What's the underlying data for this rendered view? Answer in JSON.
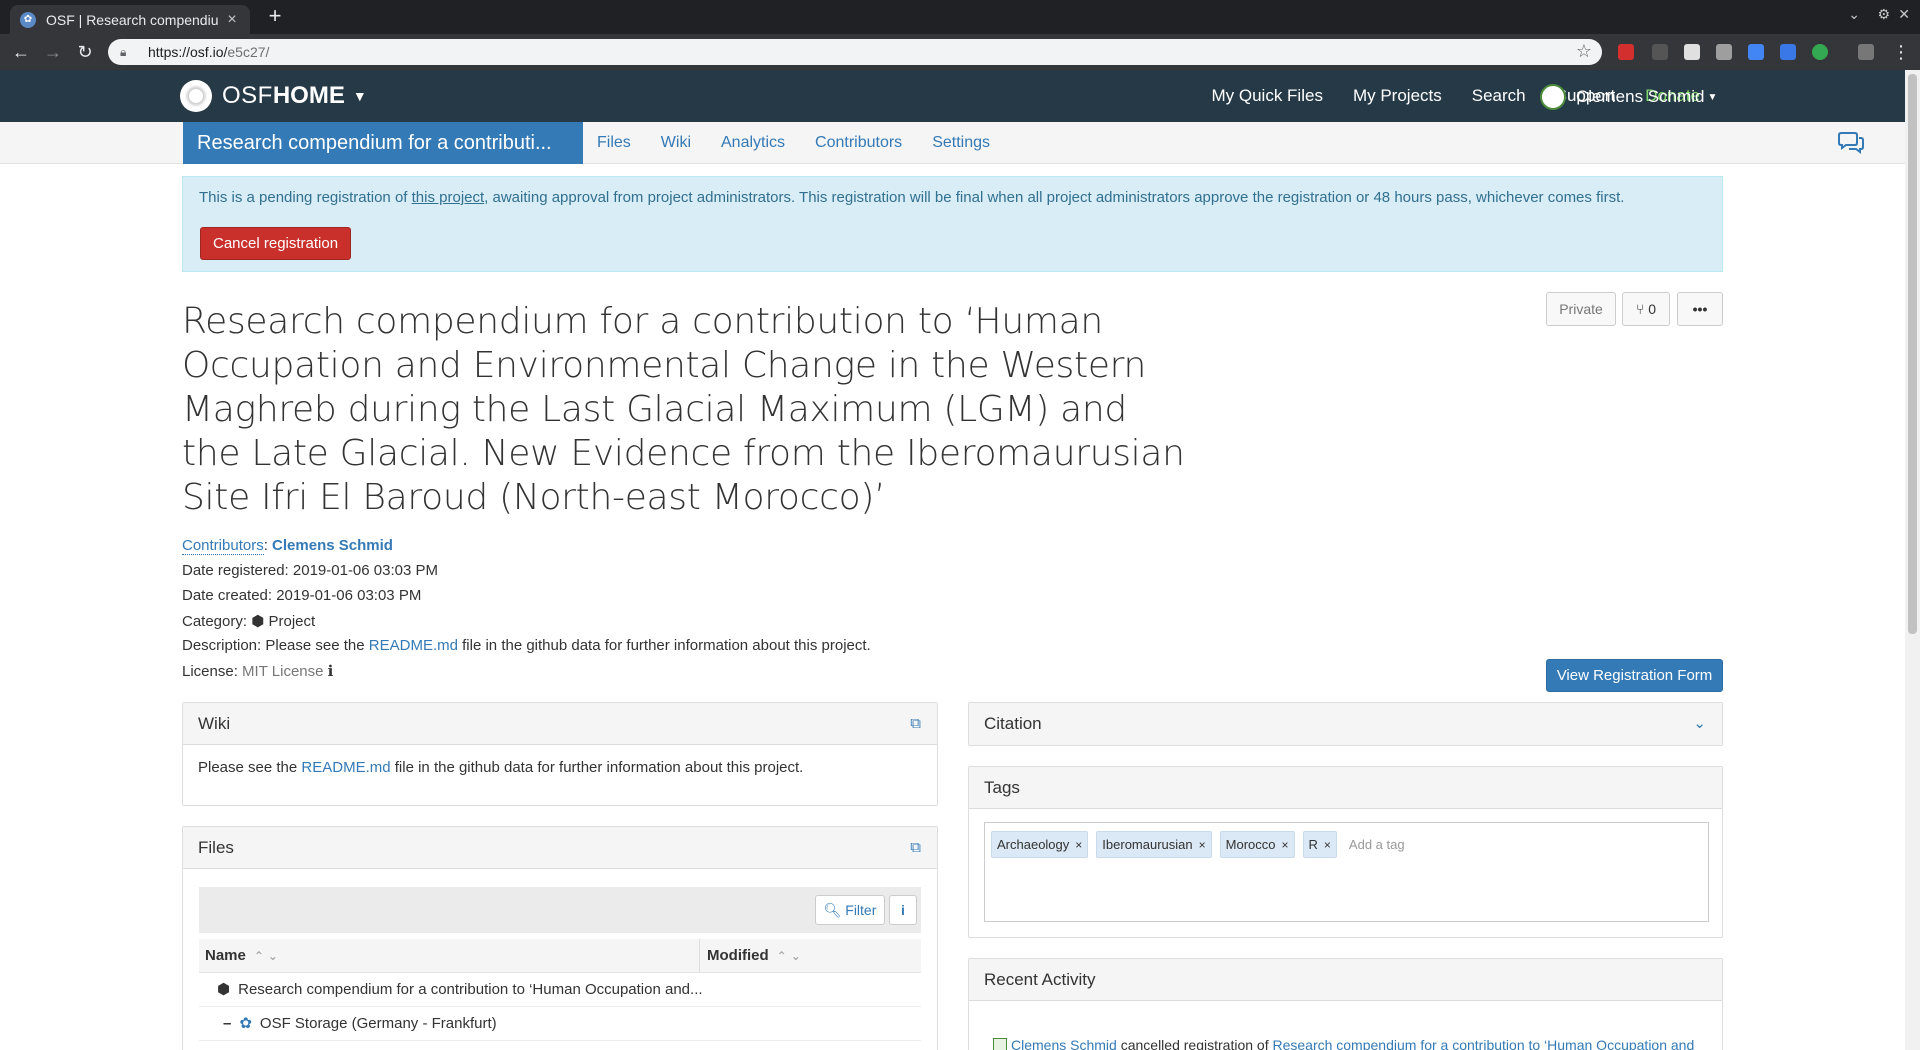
{
  "browser": {
    "tab_title": "OSF | Research compendium f",
    "url_host": "https://osf.io/",
    "url_path": "e5c27/"
  },
  "osfnav": {
    "logo_osf": "OSF",
    "logo_home": "HOME",
    "links": [
      "My Quick Files",
      "My Projects",
      "Search",
      "Support",
      "Donate"
    ],
    "user": "Clemens Schmid"
  },
  "subnav": {
    "project_title": "Research compendium for a contributi...",
    "links": [
      "Files",
      "Wiki",
      "Analytics",
      "Contributors",
      "Settings"
    ]
  },
  "alert": {
    "pre": "This is a pending registration of ",
    "link": "this project",
    "post": ", awaiting approval from project administrators. This registration will be final when all project administrators approve the registration or 48 hours pass, whichever comes first.",
    "cancel_label": "Cancel registration"
  },
  "actions": {
    "private_label": "Private",
    "fork_count": "0",
    "more_label": "•••"
  },
  "title": "Research compendium for a contribution to ‘Human Occupation and Environmental Change in the Western Maghreb during the Last Glacial Maximum (LGM) and the Late Glacial. New Evidence from the Iberomaurusian Site Ifri El Baroud (North-east Morocco)’",
  "meta": {
    "contributors_label": "Contributors",
    "contributor": "Clemens Schmid",
    "date_registered": "Date registered: 2019-01-06 03:03 PM",
    "date_created": "Date created: 2019-01-06 03:03 PM",
    "category_label": "Category:",
    "category_value": "Project",
    "description_pre": "Description: Please see the ",
    "description_link": "README.md",
    "description_post": " file in the github data for further information about this project.",
    "license_label": "License:",
    "license_value": "MIT License"
  },
  "view_form_label": "View Registration Form",
  "wiki": {
    "heading": "Wiki",
    "pre": "Please see the ",
    "link": "README.md",
    "post": " file in the github data for further information about this project."
  },
  "files": {
    "heading": "Files",
    "filter_label": "Filter",
    "col_name": "Name",
    "col_modified": "Modified",
    "rows": [
      "Research compendium for a contribution to ‘Human Occupation and...",
      "OSF Storage (Germany - Frankfurt)"
    ]
  },
  "citation": {
    "heading": "Citation"
  },
  "tags": {
    "heading": "Tags",
    "items": [
      "Archaeology",
      "Iberomaurusian",
      "Morocco",
      "R"
    ],
    "placeholder": "Add a tag"
  },
  "activity": {
    "heading": "Recent Activity",
    "user": "Clemens Schmid",
    "action": " cancelled registration of ",
    "target": "Research compendium for a contribution to ‘Human Occupation and"
  },
  "colors": {
    "navbar": "#263947",
    "primary": "#337ab7",
    "danger": "#c9302c",
    "donate": "#80d96a",
    "alert_bg": "#d9edf7"
  }
}
